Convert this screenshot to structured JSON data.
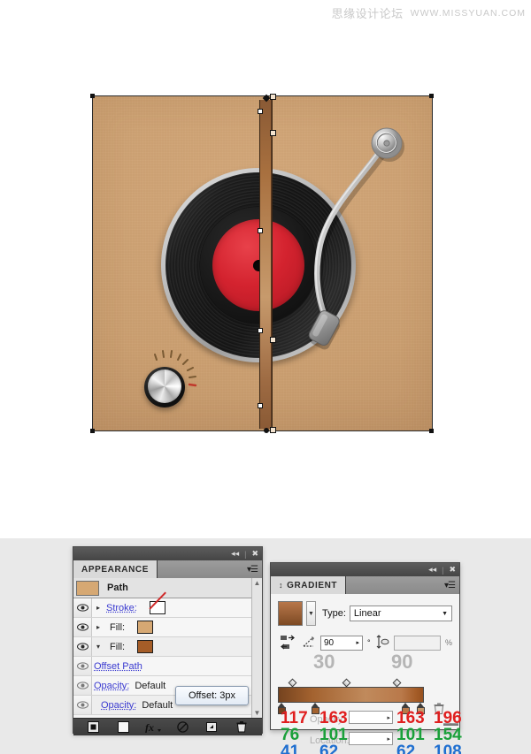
{
  "watermark": {
    "cn": "思缘设计论坛",
    "url": "WWW.MISSYUAN.COM"
  },
  "illustration": {
    "name": "retro-turntable-record-player",
    "cabinet_color": "#cb9f70",
    "record_label_color": "#d4232f",
    "record_color": "#1a1a1a",
    "tonearm_color": "#cfcfcf",
    "knob_color": "#e0e0e0",
    "tick_accent_color": "#c0392b",
    "selected_path_label": "selected-vertical-gradient-path"
  },
  "appearance_panel": {
    "title": "APPEARANCE",
    "chrome": {
      "collapse_icon": "collapse-double-arrow-icon",
      "close_icon": "close-icon",
      "menu_icon": "panel-menu-icon"
    },
    "header": {
      "label": "Path",
      "swatch_color": "#d6a873"
    },
    "rows": [
      {
        "label": "Stroke:",
        "kind": "link",
        "swatch": "none",
        "swatch_color": "#ffffff",
        "triangle": "right",
        "eye": true
      },
      {
        "label": "Fill:",
        "kind": "plain",
        "swatch": "fill",
        "swatch_color": "#d6a873",
        "triangle": "right",
        "eye": true
      },
      {
        "label": "Fill:",
        "kind": "plain",
        "swatch": "fill",
        "swatch_color": "#a55d28",
        "triangle": "down",
        "eye": true
      },
      {
        "label": "Offset Path",
        "kind": "link",
        "swatch": "",
        "swatch_color": "",
        "triangle": "",
        "eye": true
      },
      {
        "label": "Opacity:",
        "kind": "link",
        "value": "Default",
        "swatch": "",
        "swatch_color": "",
        "triangle": "",
        "eye": true
      },
      {
        "label": "Opacity:",
        "kind": "link",
        "value": "Default",
        "swatch": "",
        "swatch_color": "",
        "triangle": "",
        "eye": true
      }
    ],
    "tooltip": "Offset: 3px",
    "footer_buttons": [
      {
        "name": "add-new-stroke-button",
        "glyph": "◼"
      },
      {
        "name": "add-new-fill-button",
        "glyph": "◻"
      },
      {
        "name": "add-new-effect-button",
        "glyph": "fx"
      },
      {
        "name": "clear-appearance-button",
        "glyph": "⊘"
      },
      {
        "name": "duplicate-item-button",
        "glyph": "⧉"
      },
      {
        "name": "delete-item-button",
        "glyph": "🗑"
      }
    ],
    "scroll_up_icon": "scroll-up-arrow-icon",
    "scroll_down_icon": "scroll-down-arrow-icon"
  },
  "gradient_panel": {
    "title": "GRADIENT",
    "chrome": {
      "collapse_icon": "collapse-double-arrow-icon",
      "close_icon": "close-icon",
      "menu_icon": "panel-menu-icon"
    },
    "type_label": "Type:",
    "type_value": "Linear",
    "swatch_color": "#a0622f",
    "reverse_icon": "reverse-gradient-icon",
    "angle_icon": "gradient-angle-icon",
    "angle_value": "90",
    "degree_symbol": "°",
    "aspect_icon": "aspect-ratio-icon",
    "aspect_value": "",
    "percent_symbol": "%",
    "ghost_numbers": [
      "30",
      "90"
    ],
    "ghost_labels": [
      "Opacity:",
      "Location:"
    ],
    "overlay_percent": "%",
    "stops": [
      {
        "position_pct": 0,
        "color": "#754220"
      },
      {
        "position_pct": 23,
        "color": "#a3622f"
      },
      {
        "position_pct": 85,
        "color": "#b9794a"
      },
      {
        "position_pct": 95,
        "color": "#a55d28"
      }
    ],
    "midpoints_pct": [
      8,
      45,
      80
    ],
    "trash_icon": "delete-stop-icon",
    "rgb_values": [
      {
        "r": "117",
        "g": "76",
        "b": "41"
      },
      {
        "r": "163",
        "g": "101",
        "b": "62"
      },
      {
        "r": "163",
        "g": "101",
        "b": "62"
      },
      {
        "r": "196",
        "g": "154",
        "b": "108"
      }
    ],
    "rgb_colors": {
      "r": "#e01f1f",
      "g": "#1aa03a",
      "b": "#1f6fd0"
    },
    "resize_grip": "resize-grip"
  }
}
